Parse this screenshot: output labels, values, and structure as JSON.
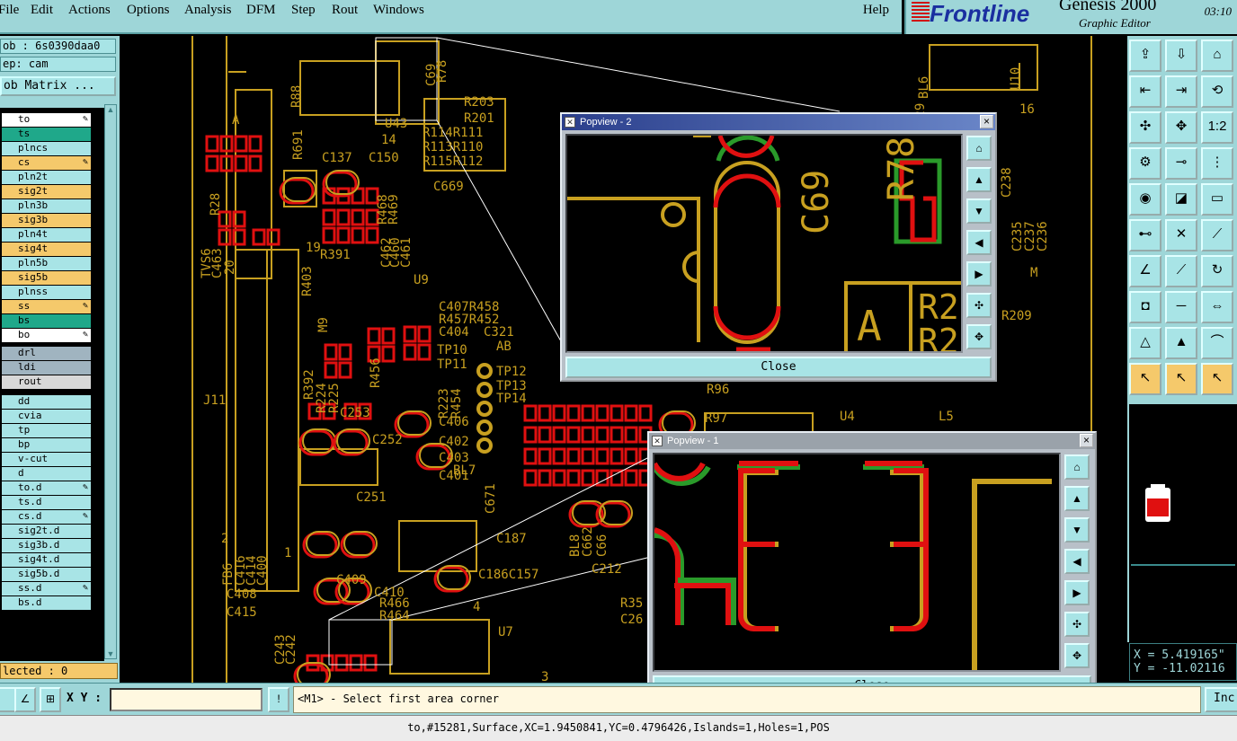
{
  "menu": {
    "items": [
      "File",
      "Edit",
      "Actions",
      "Options",
      "Analysis",
      "DFM",
      "Step",
      "Rout",
      "Windows"
    ],
    "help": "Help"
  },
  "brand": {
    "logo": "Frontline",
    "product": "Genesis 2000",
    "subtitle": "Graphic Editor",
    "time": "03:10"
  },
  "job": {
    "job_label": "ob : 6s0390daa0",
    "step_label": "ep: cam",
    "matrix_button": "ob Matrix ..."
  },
  "layers": [
    {
      "name": "to",
      "bg": "#ffffff",
      "swatch": "#1e9e1e",
      "edit": true
    },
    {
      "name": "ts",
      "bg": "#1fa88a",
      "swatch": "",
      "edit": false
    },
    {
      "name": "plncs",
      "bg": "#a8e4e6",
      "swatch": "",
      "edit": false
    },
    {
      "name": "cs",
      "bg": "#f5c96b",
      "swatch": "",
      "edit": true
    },
    {
      "name": "pln2t",
      "bg": "#a8e4e6",
      "swatch": "",
      "edit": false
    },
    {
      "name": "sig2t",
      "bg": "#f5c96b",
      "swatch": "",
      "edit": false
    },
    {
      "name": "pln3b",
      "bg": "#a8e4e6",
      "swatch": "",
      "edit": false
    },
    {
      "name": "sig3b",
      "bg": "#f5c96b",
      "swatch": "",
      "edit": false
    },
    {
      "name": "pln4t",
      "bg": "#a8e4e6",
      "swatch": "",
      "edit": false
    },
    {
      "name": "sig4t",
      "bg": "#f5c96b",
      "swatch": "",
      "edit": false
    },
    {
      "name": "pln5b",
      "bg": "#a8e4e6",
      "swatch": "",
      "edit": false
    },
    {
      "name": "sig5b",
      "bg": "#f5c96b",
      "swatch": "",
      "edit": false
    },
    {
      "name": "plnss",
      "bg": "#a8e4e6",
      "swatch": "",
      "edit": false
    },
    {
      "name": "ss",
      "bg": "#f5c96b",
      "swatch": "",
      "edit": true
    },
    {
      "name": "bs",
      "bg": "#1fa88a",
      "swatch": "",
      "edit": false
    },
    {
      "name": "bo",
      "bg": "#ffffff",
      "swatch": "",
      "edit": true
    },
    {
      "name": "drl",
      "bg": "#a0b4c0",
      "swatch": "",
      "edit": false
    },
    {
      "name": "ldi",
      "bg": "#a0b4c0",
      "swatch": "",
      "edit": false
    },
    {
      "name": "rout",
      "bg": "#d8d8d8",
      "swatch": "",
      "edit": false
    },
    {
      "name": "dd",
      "bg": "#a8e4e6",
      "swatch": "",
      "edit": false
    },
    {
      "name": "cvia",
      "bg": "#a8e4e6",
      "swatch": "",
      "edit": false
    },
    {
      "name": "tp",
      "bg": "#a8e4e6",
      "swatch": "",
      "edit": false
    },
    {
      "name": "bp",
      "bg": "#a8e4e6",
      "swatch": "",
      "edit": false
    },
    {
      "name": "v-cut",
      "bg": "#a8e4e6",
      "swatch": "",
      "edit": false
    },
    {
      "name": "d",
      "bg": "#a8e4e6",
      "swatch": "",
      "edit": false
    },
    {
      "name": "to.d",
      "bg": "#a8e4e6",
      "swatch": "#e01010",
      "edit": true
    },
    {
      "name": "ts.d",
      "bg": "#a8e4e6",
      "swatch": "",
      "edit": false
    },
    {
      "name": "cs.d",
      "bg": "#a8e4e6",
      "swatch": "",
      "edit": true
    },
    {
      "name": "sig2t.d",
      "bg": "#a8e4e6",
      "swatch": "",
      "edit": false
    },
    {
      "name": "sig3b.d",
      "bg": "#a8e4e6",
      "swatch": "",
      "edit": false
    },
    {
      "name": "sig4t.d",
      "bg": "#a8e4e6",
      "swatch": "",
      "edit": false
    },
    {
      "name": "sig5b.d",
      "bg": "#a8e4e6",
      "swatch": "",
      "edit": false
    },
    {
      "name": "ss.d",
      "bg": "#a8e4e6",
      "swatch": "",
      "edit": true
    },
    {
      "name": "bs.d",
      "bg": "#a8e4e6",
      "swatch": "",
      "edit": false
    }
  ],
  "selected": "lected : 0",
  "board_labels": [
    "R78",
    "C69",
    "U43",
    "R203",
    "R201",
    "R114R111",
    "R113R110",
    "R115R112",
    "14",
    "A",
    "R88",
    "R691",
    "C137",
    "C150",
    "C669",
    "R28",
    "R468",
    "R469",
    "TVS6",
    "C463",
    "20",
    "19",
    "R391",
    "R403",
    "C462",
    "C460",
    "C461",
    "U9",
    "C407R458",
    "R457R452",
    "C404",
    "C321",
    "TP10",
    "TP11",
    "TP12",
    "TP13",
    "TP14",
    "AB",
    "R223",
    "R454",
    "R392",
    "R224",
    "R225",
    "R456",
    "M9",
    "J11",
    "C253",
    "C252",
    "C406",
    "C402",
    "C403",
    "C401",
    "BL7",
    "C251",
    "C187",
    "C186C157",
    "C212",
    "2",
    "1",
    "FB6",
    "C416",
    "C414",
    "C400",
    "C408",
    "C415",
    "C409",
    "C410",
    "R466",
    "R464",
    "C243",
    "C242",
    "U7",
    "4",
    "R35",
    "C26",
    "R96",
    "R97",
    "U4",
    "L5",
    "BL6",
    "C29",
    "U10",
    "16",
    "C238",
    "C235",
    "C237",
    "C236",
    "M",
    "R209",
    "C671",
    "BL8",
    "C662",
    "C66",
    "3"
  ],
  "popview2": {
    "title": "Popview - 2",
    "close": "Close",
    "labels": [
      "C69",
      "R78",
      "A",
      "R2",
      "R2"
    ]
  },
  "popview1": {
    "title": "Popview - 1",
    "close": "Close"
  },
  "coords": {
    "x": "X = 5.419165\"",
    "y": "Y = -11.02116"
  },
  "command": {
    "xy_label": "X Y :",
    "xy_value": "",
    "prompt": "<M1> - Select first area corner",
    "inc_button": "Inc"
  },
  "status": "to,#15281,Surface,XC=1.9450841,YC=0.4796426,Islands=1,Holes=1,POS",
  "colors": {
    "chrome": "#9ed6d8",
    "panel_field": "#a8e4e6",
    "copper": "#c8a020",
    "pad_red": "#e01010",
    "pad_green": "#2a9a2a",
    "highlight_orange": "#f5c96b"
  }
}
